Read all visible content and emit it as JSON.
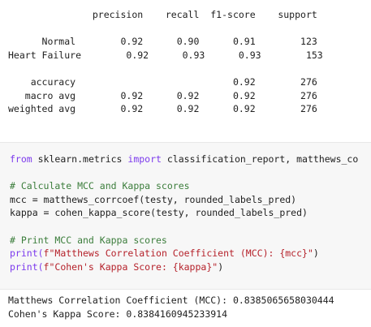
{
  "report": {
    "header": [
      "precision",
      "recall",
      "f1-score",
      "support"
    ],
    "rows": [
      {
        "label": "Normal",
        "precision": "0.92",
        "recall": "0.90",
        "f1": "0.91",
        "support": "123"
      },
      {
        "label": "Heart Failure",
        "precision": "0.92",
        "recall": "0.93",
        "f1": "0.93",
        "support": "153"
      }
    ],
    "summary": [
      {
        "label": "accuracy",
        "precision": "",
        "recall": "",
        "f1": "0.92",
        "support": "276"
      },
      {
        "label": "macro avg",
        "precision": "0.92",
        "recall": "0.92",
        "f1": "0.92",
        "support": "276"
      },
      {
        "label": "weighted avg",
        "precision": "0.92",
        "recall": "0.92",
        "f1": "0.92",
        "support": "276"
      }
    ]
  },
  "code": {
    "line1": {
      "kw_from": "from",
      "module": " sklearn.metrics ",
      "kw_import": "import",
      "rest": " classification_report, matthews_co"
    },
    "comment1": "# Calculate MCC and Kappa scores",
    "line3": "mcc = matthews_corrcoef(testy, rounded_labels_pred)",
    "line4": "kappa = cohen_kappa_score(testy, rounded_labels_pred)",
    "comment2": "# Print MCC and Kappa scores",
    "print1": {
      "fn": "print(",
      "str": "f\"Matthews Correlation Coefficient (MCC): {mcc}\"",
      "close": ")"
    },
    "print2": {
      "fn": "print(",
      "str": "f\"Cohen's Kappa Score: {kappa}\"",
      "close": ")"
    }
  },
  "output": {
    "line1": "Matthews Correlation Coefficient (MCC): 0.8385065658030444",
    "line2": "Cohen's Kappa Score: 0.8384160945233914"
  }
}
